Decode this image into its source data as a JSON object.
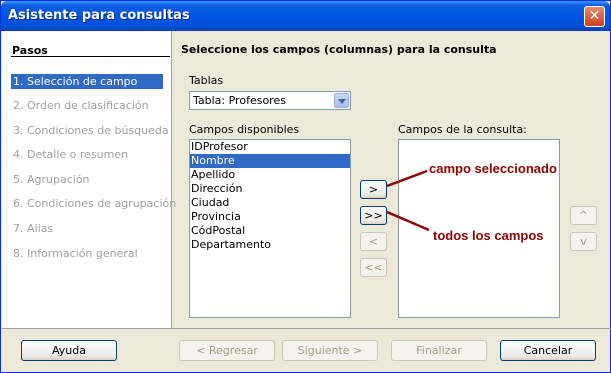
{
  "window": {
    "title": "Asistente para consultas",
    "close_glyph": "✕"
  },
  "sidebar": {
    "title": "Pasos",
    "steps": [
      {
        "label": "1.  Selección de campo",
        "active": true
      },
      {
        "label": "2.  Orden de clasificación",
        "active": false
      },
      {
        "label": "3.  Condiciones de búsqueda",
        "active": false
      },
      {
        "label": "4.  Detalle o resumen",
        "active": false
      },
      {
        "label": "5.  Agrupación",
        "active": false
      },
      {
        "label": "6.  Condiciones de agrupación",
        "active": false
      },
      {
        "label": "7.  Alias",
        "active": false
      },
      {
        "label": "8.  Información general",
        "active": false
      }
    ]
  },
  "main": {
    "heading": "Seleccione los campos (columnas) para la consulta",
    "tables_label": "Tablas",
    "tables_value": "Tabla: Profesores",
    "available_label": "Campos disponibles",
    "available_fields": [
      "IDProfesor",
      "Nombre",
      "Apellido",
      "Dirección",
      "Ciudad",
      "Provincia",
      "CódPostal",
      "Departamento"
    ],
    "selected_index": 1,
    "query_fields_label": "Campos de la consulta:",
    "query_fields": [],
    "move_buttons": {
      "add_one": ">",
      "add_all": ">>",
      "remove_one": "<",
      "remove_all": "<<"
    },
    "order_buttons": {
      "up": "^",
      "down": "v"
    }
  },
  "annotations": {
    "selected_field": "campo seleccionado",
    "all_fields": "todos los campos"
  },
  "footer": {
    "help": "Ayuda",
    "back": "< Regresar",
    "next": "Siguiente >",
    "finish": "Finalizar",
    "cancel": "Cancelar"
  },
  "colors": {
    "selection": "#316ac5",
    "annotation": "#8b0000",
    "titlebar": "#0055e5"
  }
}
